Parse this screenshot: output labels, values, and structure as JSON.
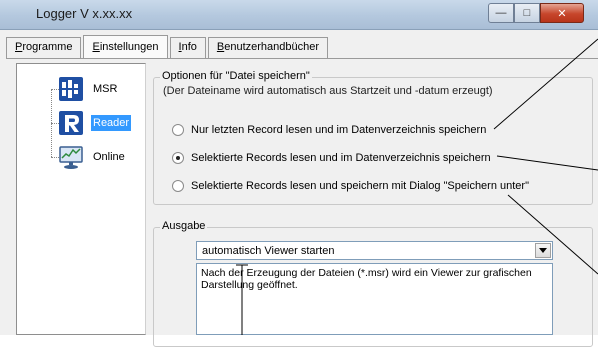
{
  "window": {
    "title": "Logger V x.xx.xx",
    "minimize_glyph": "—",
    "maximize_glyph": "□",
    "close_glyph": "✕"
  },
  "tabs": [
    {
      "label": "Programme",
      "underline": "P",
      "rest": "rogramme"
    },
    {
      "label": "Einstellungen",
      "underline": "E",
      "rest": "instellungen"
    },
    {
      "label": "Info",
      "underline": "I",
      "rest": "nfo"
    },
    {
      "label": "Benutzerhandbücher",
      "underline": "B",
      "rest": "enutzerhandbücher"
    }
  ],
  "nav": {
    "items": [
      {
        "label": "MSR",
        "icon": "msr-device-icon"
      },
      {
        "label": "Reader",
        "icon": "reader-r-icon",
        "selected": true
      },
      {
        "label": "Online",
        "icon": "online-monitor-icon"
      }
    ]
  },
  "save_options": {
    "title": "Optionen für \"Datei speichern\"",
    "hint": "(Der Dateiname wird automatisch aus Startzeit und -datum erzeugt)",
    "options": [
      {
        "label": "Nur letzten Record lesen und im Datenverzeichnis speichern",
        "checked": false
      },
      {
        "label": "Selektierte Records lesen und im Datenverzeichnis speichern",
        "checked": true
      },
      {
        "label": "Selektierte Records lesen und speichern mit Dialog \"Speichern unter\"",
        "checked": false
      }
    ]
  },
  "output": {
    "title": "Ausgabe",
    "selected": "automatisch Viewer starten",
    "description": "Nach der Erzeugung der Dateien (*.msr) wird ein Viewer zur grafischen Darstellung geöffnet."
  },
  "colors": {
    "selection": "#3399ff",
    "close_button": "#c7462b",
    "callout_line": "#000000"
  }
}
